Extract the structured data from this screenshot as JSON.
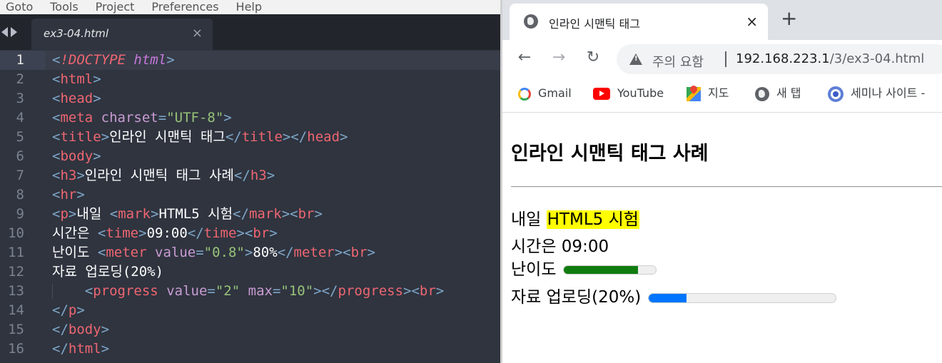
{
  "editor": {
    "menu": [
      "Goto",
      "Tools",
      "Project",
      "Preferences",
      "Help"
    ],
    "tab_title": "ex3-04.html",
    "tab_close": "×",
    "active_line": 1,
    "lines": [
      {
        "n": "1",
        "tokens": [
          [
            "p",
            "<"
          ],
          [
            "d",
            "!DOCTYPE"
          ],
          [
            "w",
            " "
          ],
          [
            "dk",
            "html"
          ],
          [
            "p",
            ">"
          ]
        ]
      },
      {
        "n": "2",
        "tokens": [
          [
            "p",
            "<"
          ],
          [
            "t",
            "html"
          ],
          [
            "p",
            ">"
          ]
        ]
      },
      {
        "n": "3",
        "tokens": [
          [
            "p",
            "<"
          ],
          [
            "t",
            "head"
          ],
          [
            "p",
            ">"
          ]
        ]
      },
      {
        "n": "4",
        "tokens": [
          [
            "p",
            "<"
          ],
          [
            "t",
            "meta"
          ],
          [
            "w",
            " "
          ],
          [
            "a",
            "charset"
          ],
          [
            "p",
            "="
          ],
          [
            "s",
            "\"UTF-8\""
          ],
          [
            "p",
            ">"
          ]
        ]
      },
      {
        "n": "5",
        "tokens": [
          [
            "p",
            "<"
          ],
          [
            "t",
            "title"
          ],
          [
            "p",
            ">"
          ],
          [
            "w",
            "인라인 시맨틱 태그"
          ],
          [
            "p",
            "</"
          ],
          [
            "t",
            "title"
          ],
          [
            "p",
            "></"
          ],
          [
            "t",
            "head"
          ],
          [
            "p",
            ">"
          ]
        ]
      },
      {
        "n": "6",
        "tokens": [
          [
            "p",
            "<"
          ],
          [
            "t",
            "body"
          ],
          [
            "p",
            ">"
          ]
        ]
      },
      {
        "n": "7",
        "tokens": [
          [
            "p",
            "<"
          ],
          [
            "t",
            "h3"
          ],
          [
            "p",
            ">"
          ],
          [
            "w",
            "인라인 시맨틱 태그 사례"
          ],
          [
            "p",
            "</"
          ],
          [
            "t",
            "h3"
          ],
          [
            "p",
            ">"
          ]
        ]
      },
      {
        "n": "8",
        "tokens": [
          [
            "p",
            "<"
          ],
          [
            "t",
            "hr"
          ],
          [
            "p",
            ">"
          ]
        ]
      },
      {
        "n": "9",
        "tokens": [
          [
            "p",
            "<"
          ],
          [
            "t",
            "p"
          ],
          [
            "p",
            ">"
          ],
          [
            "w",
            "내일 "
          ],
          [
            "p",
            "<"
          ],
          [
            "t",
            "mark"
          ],
          [
            "p",
            ">"
          ],
          [
            "w",
            "HTML5 시험"
          ],
          [
            "p",
            "</"
          ],
          [
            "t",
            "mark"
          ],
          [
            "p",
            "><"
          ],
          [
            "t",
            "br"
          ],
          [
            "p",
            ">"
          ]
        ]
      },
      {
        "n": "10",
        "tokens": [
          [
            "w",
            "시간은 "
          ],
          [
            "p",
            "<"
          ],
          [
            "t",
            "time"
          ],
          [
            "p",
            ">"
          ],
          [
            "w",
            "09:00"
          ],
          [
            "p",
            "</"
          ],
          [
            "t",
            "time"
          ],
          [
            "p",
            "><"
          ],
          [
            "t",
            "br"
          ],
          [
            "p",
            ">"
          ]
        ]
      },
      {
        "n": "11",
        "tokens": [
          [
            "w",
            "난이도 "
          ],
          [
            "p",
            "<"
          ],
          [
            "t",
            "meter"
          ],
          [
            "w",
            " "
          ],
          [
            "a",
            "value"
          ],
          [
            "p",
            "="
          ],
          [
            "s",
            "\"0.8\""
          ],
          [
            "p",
            ">"
          ],
          [
            "w",
            "80%"
          ],
          [
            "p",
            "</"
          ],
          [
            "t",
            "meter"
          ],
          [
            "p",
            "><"
          ],
          [
            "t",
            "br"
          ],
          [
            "p",
            ">"
          ]
        ]
      },
      {
        "n": "12",
        "tokens": [
          [
            "w",
            "자료 업로딩(20%)"
          ]
        ]
      },
      {
        "n": "13",
        "guide": true,
        "tokens": [
          [
            "w",
            "    "
          ],
          [
            "p",
            "<"
          ],
          [
            "t",
            "progress"
          ],
          [
            "w",
            " "
          ],
          [
            "a",
            "value"
          ],
          [
            "p",
            "="
          ],
          [
            "s",
            "\"2\""
          ],
          [
            "w",
            " "
          ],
          [
            "a",
            "max"
          ],
          [
            "p",
            "="
          ],
          [
            "s",
            "\"10\""
          ],
          [
            "p",
            "></"
          ],
          [
            "t",
            "progress"
          ],
          [
            "p",
            "><"
          ],
          [
            "t",
            "br"
          ],
          [
            "p",
            ">"
          ]
        ]
      },
      {
        "n": "14",
        "tokens": [
          [
            "p",
            "</"
          ],
          [
            "t",
            "p"
          ],
          [
            "p",
            ">"
          ]
        ]
      },
      {
        "n": "15",
        "tokens": [
          [
            "p",
            "</"
          ],
          [
            "t",
            "body"
          ],
          [
            "p",
            ">"
          ]
        ]
      },
      {
        "n": "16",
        "tokens": [
          [
            "p",
            "</"
          ],
          [
            "t",
            "html"
          ],
          [
            "p",
            ">"
          ]
        ]
      }
    ]
  },
  "browser": {
    "tab_title": "인라인 시맨틱 태그",
    "tab_close": "×",
    "new_tab": "+",
    "nav": {
      "back": "←",
      "forward": "→",
      "reload": "↻"
    },
    "security_text": "주의 요함",
    "url_host": "192.168.223.1",
    "url_path": "/3/ex3-04.html",
    "bookmarks": [
      {
        "label": "Gmail",
        "icon": "google-icon"
      },
      {
        "label": "YouTube",
        "icon": "youtube-icon"
      },
      {
        "label": "지도",
        "icon": "maps-icon"
      },
      {
        "label": "새 탭",
        "icon": "globe-icon"
      },
      {
        "label": "세미나 사이트 -",
        "icon": "chrome-icon"
      }
    ],
    "page": {
      "heading": "인라인 시맨틱 태그 사례",
      "line1_prefix": "내일 ",
      "line1_mark": "HTML5 시험",
      "line2_prefix": "시간은 ",
      "line2_time": "09:00",
      "line3_label": "난이도",
      "meter_value": 0.8,
      "line4_label": "자료 업로딩(20%)",
      "progress_value": 2,
      "progress_max": 10
    },
    "colors": {
      "mark": "#ffff00",
      "meter_fill": "#107c10",
      "progress_fill": "#0075ff"
    }
  }
}
